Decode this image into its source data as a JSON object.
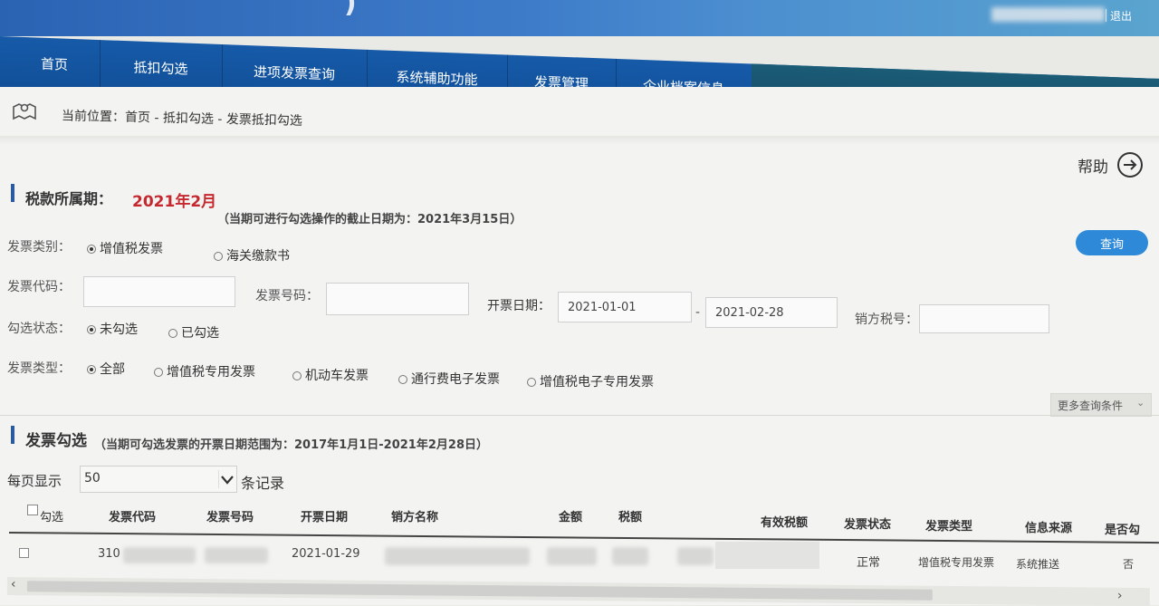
{
  "header": {
    "logout": "退出"
  },
  "nav": {
    "items": [
      "首页",
      "抵扣勾选",
      "进项发票查询",
      "系统辅助功能",
      "发票管理",
      "企业档案信息"
    ]
  },
  "breadcrumb": {
    "text": "当前位置：首页 - 抵扣勾选 - 发票抵扣勾选"
  },
  "help": {
    "label": "帮助"
  },
  "tax_period": {
    "label": "税款所属期：",
    "value": "2021年2月",
    "note": "（当期可进行勾选操作的截止日期为：2021年3月15日）"
  },
  "query_button": "查询",
  "filters": {
    "invoice_category_label": "发票类别：",
    "invoice_category_options": [
      "增值税发票",
      "海关缴款书"
    ],
    "invoice_code_label": "发票代码：",
    "invoice_number_label": "发票号码：",
    "issue_date_label": "开票日期：",
    "date_from": "2021-01-01",
    "date_sep": "-",
    "date_to": "2021-02-28",
    "seller_tax_id_label": "销方税号：",
    "select_status_label": "勾选状态：",
    "select_status_options": [
      "未勾选",
      "已勾选"
    ],
    "invoice_type_label": "发票类型：",
    "invoice_type_options": [
      "全部",
      "增值税专用发票",
      "机动车发票",
      "通行费电子发票",
      "增值税电子专用发票"
    ],
    "more_conditions": "更多查询条件"
  },
  "invoice_select": {
    "title": "发票勾选",
    "note": "（当期可勾选发票的开票日期范围为：2017年1月1日-2021年2月28日）",
    "per_page_label": "每页显示",
    "per_page_value": "50",
    "records_label": "条记录"
  },
  "table": {
    "headers": [
      "勾选",
      "发票代码",
      "发票号码",
      "开票日期",
      "销方名称",
      "金额",
      "税额",
      "有效税额",
      "发票状态",
      "发票类型",
      "信息来源",
      "是否勾"
    ],
    "row": {
      "code": "310",
      "date": "2021-01-29",
      "status": "正常",
      "type": "增值税专用发票",
      "source": "系统推送",
      "selected": "否"
    }
  }
}
